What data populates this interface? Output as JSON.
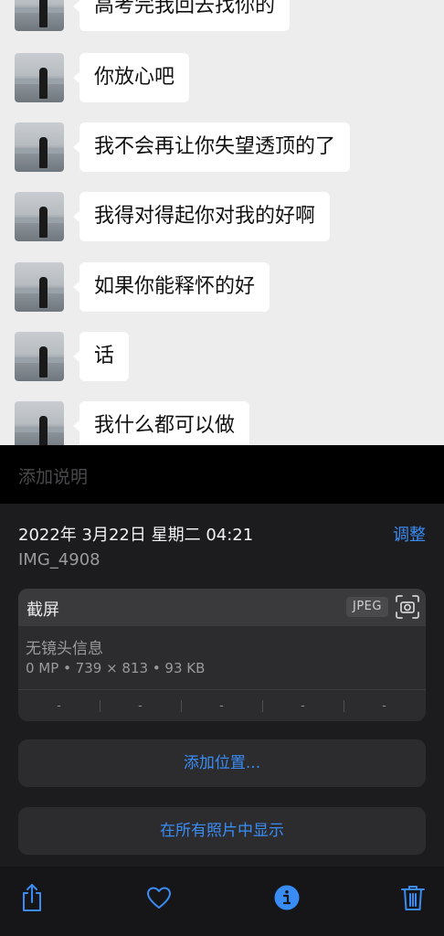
{
  "chat": {
    "messages": [
      {
        "text": "高考完我回去找你的"
      },
      {
        "text": "你放心吧"
      },
      {
        "text": "我不会再让你失望透顶的了"
      },
      {
        "text": "我得对得起你对我的好啊"
      },
      {
        "text": "如果你能释怀的好"
      },
      {
        "text": "话"
      },
      {
        "text": "我什么都可以做"
      }
    ]
  },
  "caption": {
    "placeholder": "添加说明"
  },
  "info": {
    "datetime": "2022年 3月22日 星期二 04:21",
    "adjust_label": "调整",
    "filename": "IMG_4908",
    "card": {
      "title": "截屏",
      "format_badge": "JPEG",
      "lens": "无镜头信息",
      "specs": "0 MP • 739 × 813 • 93 KB",
      "exif": [
        "-",
        "-",
        "-",
        "-",
        "-"
      ]
    },
    "add_location_label": "添加位置...",
    "show_in_all_photos_label": "在所有照片中显示"
  },
  "toolbar": {
    "icons": [
      "share-icon",
      "heart-icon",
      "info-icon",
      "trash-icon"
    ],
    "accent_color": "#3a8cf5"
  },
  "colors": {
    "accent": "#3a8cf5",
    "chat_bg": "#ededed",
    "panel_bg": "#1c1c1e"
  }
}
